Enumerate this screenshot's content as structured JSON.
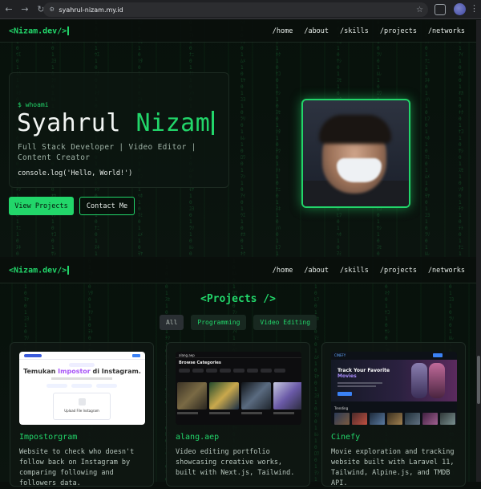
{
  "browser": {
    "url": "syahrul-nizam.my.id"
  },
  "nav": {
    "logo": "<Nizam.dev/>",
    "links": [
      "/home",
      "/about",
      "/skills",
      "/projects",
      "/networks"
    ]
  },
  "hero": {
    "prompt": "$ whoami",
    "first_name": "Syahrul",
    "last_name": "Nizam",
    "subtitle": "Full Stack Developer | Video Editor | Content Creator",
    "code": "console.log('Hello, World!')",
    "primary_button": "View Projects",
    "secondary_button": "Contact Me"
  },
  "projects": {
    "heading": "<Projects />",
    "filters": [
      "All",
      "Programming",
      "Video Editing"
    ],
    "active_filter": "All",
    "items": [
      {
        "title": "Impostorgram",
        "description": "Website to check who doesn't follow back on Instagram by comparing following and followers data.",
        "preview": {
          "headline_plain": "Temukan ",
          "headline_accent": "Impostor",
          "headline_rest": " di Instagram.",
          "upload_text": "Upload File Instagram"
        }
      },
      {
        "title": "alang.aep",
        "description": "Video editing portfolio showcasing creative works, built with Next.js, Tailwind.",
        "preview": {
          "logo": "alang.aep",
          "section": "Browse Categories"
        }
      },
      {
        "title": "Cinefy",
        "description": "Movie exploration and tracking website built with Laravel 11, Tailwind, Alpine.js, and TMDB API.",
        "preview": {
          "logo": "CINEFY",
          "headline": "Track Your Favorite",
          "headline_accent": "Movies",
          "section": "Trending"
        }
      }
    ]
  },
  "colors": {
    "accent": "#22d66a",
    "background": "#0a0f0c"
  }
}
